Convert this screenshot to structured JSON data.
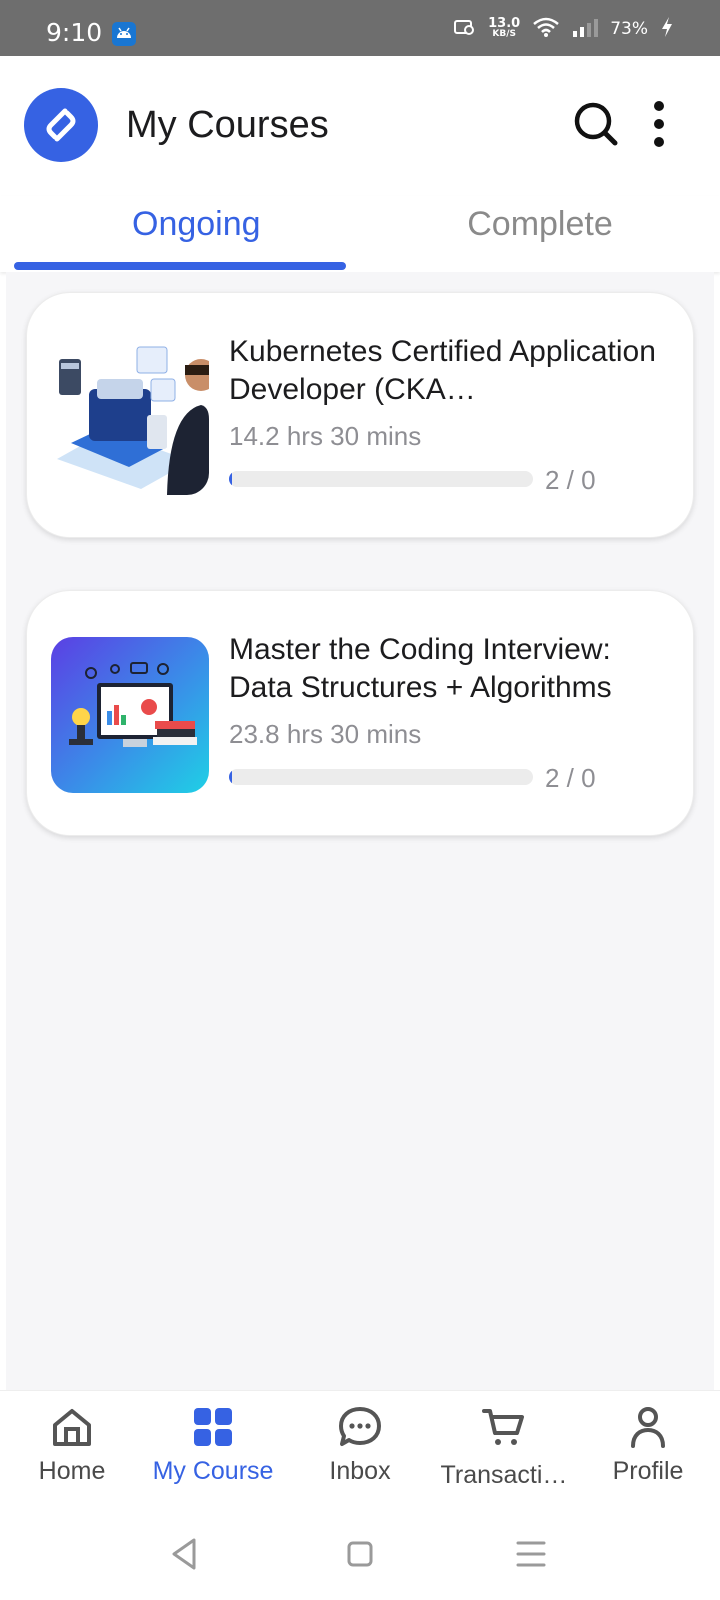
{
  "status_bar": {
    "time": "9:10",
    "net_speed_value": "13.0",
    "net_speed_unit": "KB/S",
    "battery": "73%"
  },
  "header": {
    "title": "My Courses"
  },
  "tabs": [
    {
      "label": "Ongoing",
      "active": true
    },
    {
      "label": "Complete",
      "active": false
    }
  ],
  "courses": [
    {
      "title": "Kubernetes Certified Application Developer (CKA…",
      "duration": "14.2 hrs 30 mins",
      "progress_count": "2 / 0",
      "progress_fraction": 0.01
    },
    {
      "title": "Master the Coding Interview: Data Structures + Algorithms",
      "duration": "23.8 hrs 30 mins",
      "progress_count": "2 / 0",
      "progress_fraction": 0.01
    }
  ],
  "bottom_nav": [
    {
      "label": "Home",
      "icon": "home-icon",
      "active": false
    },
    {
      "label": "My Course",
      "icon": "grid-icon",
      "active": true
    },
    {
      "label": "Inbox",
      "icon": "chat-icon",
      "active": false
    },
    {
      "label": "Transacti…",
      "icon": "cart-icon",
      "active": false
    },
    {
      "label": "Profile",
      "icon": "person-icon",
      "active": false
    }
  ],
  "colors": {
    "accent": "#3662e3",
    "muted_text": "#8e8e93",
    "track": "#ececec"
  }
}
